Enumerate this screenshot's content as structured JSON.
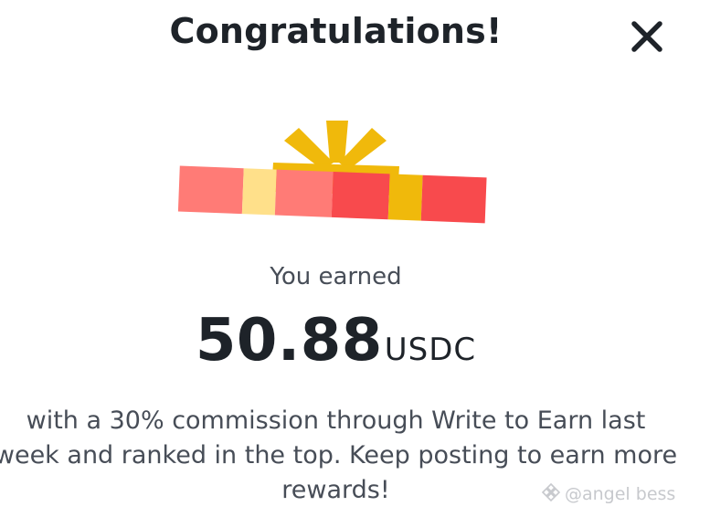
{
  "dialog": {
    "title": "Congratulations!",
    "close_icon": "close-icon",
    "illustration": "gift-box-icon",
    "earned_label": "You earned",
    "amount": "50.88",
    "currency": "USDC",
    "description": "with a 30% commission through Write to Earn last week and ranked in the top. Keep posting to earn more rewards!"
  },
  "watermark": {
    "icon": "binance-logo-icon",
    "text": "@angel bess"
  },
  "colors": {
    "text_primary": "#1e2329",
    "text_secondary": "#474d57",
    "gift_coral": "#ff7b76",
    "gift_red": "#f84a4d",
    "gift_yellow": "#f0b90b",
    "gift_pale_yellow": "#ffe08a"
  }
}
